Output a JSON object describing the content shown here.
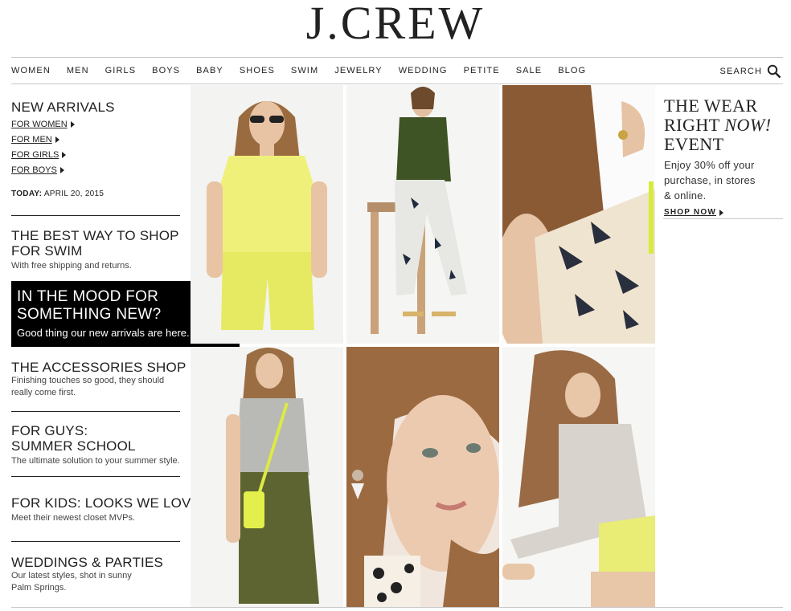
{
  "brand": {
    "logo": "J.CREW"
  },
  "nav": {
    "items": [
      "WOMEN",
      "MEN",
      "GIRLS",
      "BOYS",
      "BABY",
      "SHOES",
      "SWIM",
      "JEWELRY",
      "WEDDING",
      "PETITE",
      "SALE",
      "BLOG"
    ],
    "search_label": "SEARCH"
  },
  "sidebar": {
    "new_arrivals": {
      "title": "NEW ARRIVALS",
      "links": [
        "FOR WOMEN",
        "FOR MEN",
        "FOR GIRLS",
        "FOR BOYS"
      ]
    },
    "today_label": "TODAY:",
    "today_date": "APRIL 20, 2015",
    "swim": {
      "title_1": "THE BEST WAY TO SHOP",
      "title_2": "FOR SWIM",
      "desc": "With free shipping and returns."
    },
    "promo": {
      "line_1": "IN THE MOOD FOR",
      "line_2": "SOMETHING NEW?",
      "sub": "Good thing our new arrivals are here."
    },
    "accessories": {
      "title": "THE ACCESSORIES SHOP",
      "desc_1": "Finishing touches so good, they should",
      "desc_2": "really come first."
    },
    "guys": {
      "title_1": "FOR GUYS:",
      "title_2": "SUMMER SCHOOL",
      "desc": "The ultimate solution to your summer style."
    },
    "kids": {
      "title": "FOR KIDS: LOOKS WE LOVE",
      "desc": "Meet their newest closet MVPs."
    },
    "weddings": {
      "title": "WEDDINGS & PARTIES",
      "desc_1": "Our latest styles, shot in sunny",
      "desc_2": "Palm Springs."
    }
  },
  "event": {
    "title_1": "THE WEAR",
    "title_2a": "RIGHT ",
    "title_2b": "NOW!",
    "title_3": "EVENT",
    "desc_1": "Enjoy 30% off your",
    "desc_2": "purchase, in stores",
    "desc_3": "& online.",
    "cta": "SHOP NOW"
  },
  "colors": {
    "accent_yellow": "#eef07a",
    "olive": "#4a5a2a",
    "black": "#000000"
  }
}
